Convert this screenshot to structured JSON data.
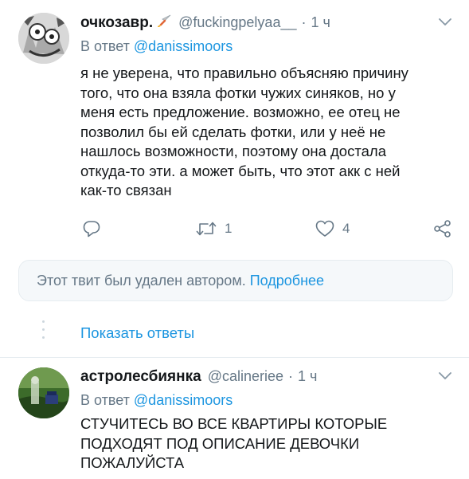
{
  "tweets": [
    {
      "display_name": "очкозавр.",
      "handle": "@fuckingpelyaa__",
      "separator": "·",
      "time": "1 ч",
      "reply_prefix": "В ответ",
      "reply_handle": "@danissimoors",
      "text_lines": [
        "я не уверена, что правильно объясняю причину",
        "того, что она взяла фотки чужих синяков, но у",
        "меня есть предложение. возможно, ее отец не",
        "позволил бы ей сделать фотки, или у неё не",
        "нашлось возможности, поэтому она достала",
        "откуда-то эти. а может быть, что этот акк с ней",
        "как-то связан"
      ],
      "actions": {
        "reply_count": "",
        "retweet_count": "1",
        "like_count": "4"
      },
      "icons": [
        "avatar",
        "rocket-icon",
        "chevron-down-icon",
        "reply-icon",
        "retweet-icon",
        "like-icon",
        "share-icon"
      ]
    },
    {
      "display_name": "астролесбиянка",
      "handle": "@calineriee",
      "separator": "·",
      "time": "1 ч",
      "reply_prefix": "В ответ",
      "reply_handle": "@danissimoors",
      "text_lines": [
        "СТУЧИТЕСЬ ВО ВСЕ КВАРТИРЫ КОТОРЫЕ",
        "ПОДХОДЯТ ПОД ОПИСАНИЕ ДЕВОЧКИ",
        "ПОЖАЛУЙСТА"
      ],
      "icons": [
        "avatar",
        "chevron-down-icon"
      ]
    }
  ],
  "deleted_notice": {
    "message": "Этот твит был удален автором.",
    "link": "Подробнее"
  },
  "show_replies": "Показать ответы",
  "colors": {
    "text": "#14171a",
    "secondary": "#657786",
    "accent": "#1b95e0",
    "border": "#e6ecf0",
    "notice_bg": "#f5f8fa"
  }
}
